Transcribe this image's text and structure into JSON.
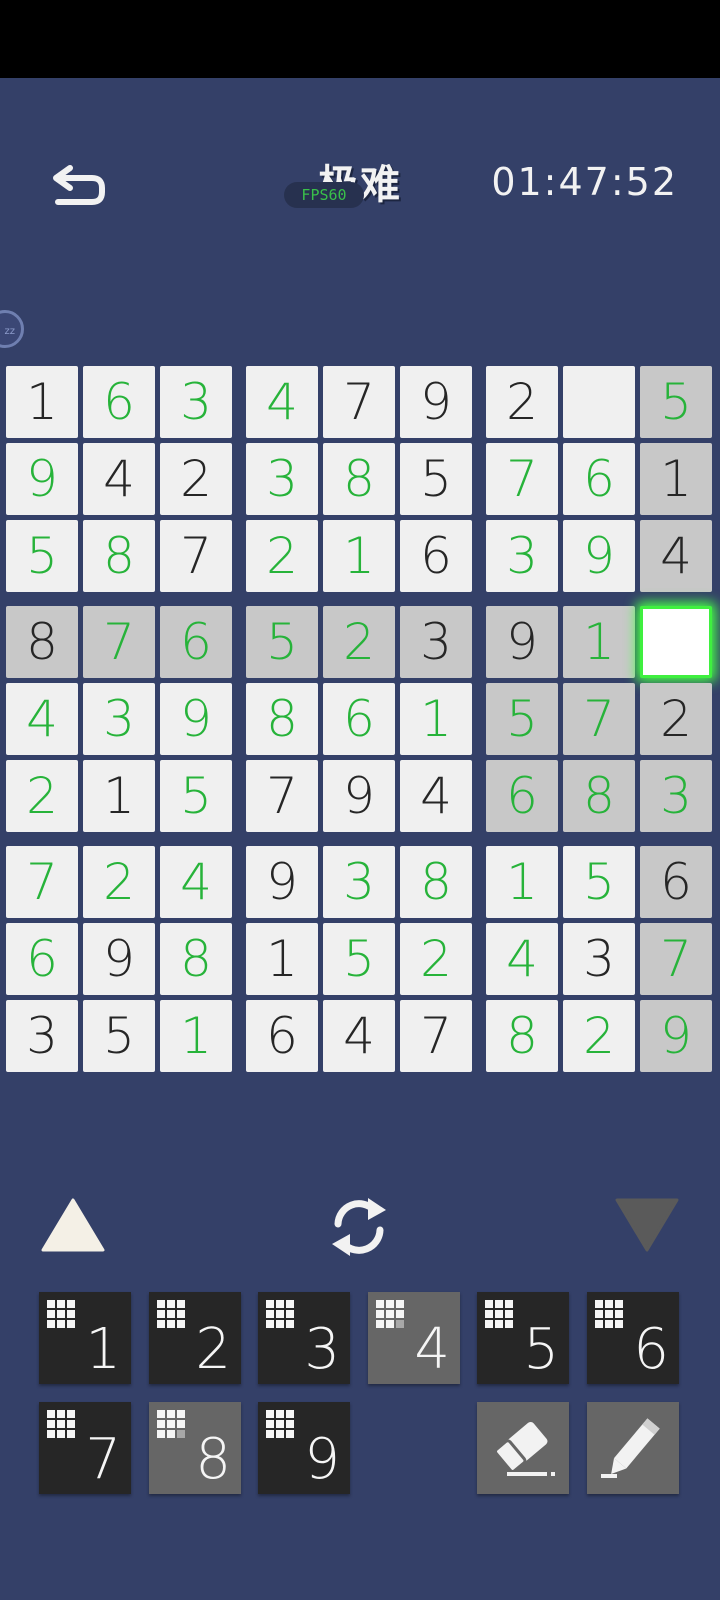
{
  "header": {
    "back_icon": "undo-arrow-icon",
    "difficulty": "极难",
    "fps_badge": "FPS60",
    "timer": "01:47:52",
    "side_bubble": "zz"
  },
  "board": {
    "rows": [
      [
        "1",
        "6",
        "3",
        "4",
        "7",
        "9",
        "2",
        "",
        "5"
      ],
      [
        "9",
        "4",
        "2",
        "3",
        "8",
        "5",
        "7",
        "6",
        "1"
      ],
      [
        "5",
        "8",
        "7",
        "2",
        "1",
        "6",
        "3",
        "9",
        "4"
      ],
      [
        "8",
        "7",
        "6",
        "5",
        "2",
        "3",
        "9",
        "1",
        ""
      ],
      [
        "4",
        "3",
        "9",
        "8",
        "6",
        "1",
        "5",
        "7",
        "2"
      ],
      [
        "2",
        "1",
        "5",
        "7",
        "9",
        "4",
        "6",
        "8",
        "3"
      ],
      [
        "7",
        "2",
        "4",
        "9",
        "3",
        "8",
        "1",
        "5",
        "6"
      ],
      [
        "6",
        "9",
        "8",
        "1",
        "5",
        "2",
        "4",
        "3",
        "7"
      ],
      [
        "3",
        "5",
        "1",
        "6",
        "4",
        "7",
        "8",
        "2",
        "9"
      ]
    ],
    "entered": [
      [
        0,
        1,
        1,
        1,
        0,
        0,
        0,
        0,
        1
      ],
      [
        1,
        0,
        0,
        1,
        1,
        0,
        1,
        1,
        0
      ],
      [
        1,
        1,
        0,
        1,
        1,
        0,
        1,
        1,
        0
      ],
      [
        0,
        1,
        1,
        1,
        1,
        0,
        0,
        1,
        0
      ],
      [
        1,
        1,
        1,
        1,
        1,
        1,
        1,
        1,
        0
      ],
      [
        1,
        0,
        1,
        0,
        0,
        0,
        1,
        1,
        1
      ],
      [
        1,
        1,
        1,
        0,
        1,
        1,
        1,
        1,
        0
      ],
      [
        1,
        0,
        1,
        0,
        1,
        1,
        1,
        0,
        1
      ],
      [
        0,
        0,
        1,
        0,
        0,
        0,
        1,
        1,
        1
      ]
    ],
    "highlighted": [
      [
        0,
        0,
        0,
        0,
        0,
        0,
        0,
        0,
        1
      ],
      [
        0,
        0,
        0,
        0,
        0,
        0,
        0,
        0,
        1
      ],
      [
        0,
        0,
        0,
        0,
        0,
        0,
        0,
        0,
        1
      ],
      [
        1,
        1,
        1,
        1,
        1,
        1,
        1,
        1,
        0
      ],
      [
        0,
        0,
        0,
        0,
        0,
        0,
        1,
        1,
        1
      ],
      [
        0,
        0,
        0,
        0,
        0,
        0,
        1,
        1,
        1
      ],
      [
        0,
        0,
        0,
        0,
        0,
        0,
        0,
        0,
        1
      ],
      [
        0,
        0,
        0,
        0,
        0,
        0,
        0,
        0,
        1
      ],
      [
        0,
        0,
        0,
        0,
        0,
        0,
        0,
        0,
        1
      ]
    ],
    "selected": {
      "row": 3,
      "col": 8
    }
  },
  "controls": {
    "up_icon": "triangle-up-icon",
    "down_icon": "triangle-down-icon",
    "refresh_icon": "refresh-icon"
  },
  "keypad": {
    "keys": [
      {
        "label": "1",
        "highlighted": false,
        "dim_dots": 0
      },
      {
        "label": "2",
        "highlighted": false,
        "dim_dots": 0
      },
      {
        "label": "3",
        "highlighted": false,
        "dim_dots": 0
      },
      {
        "label": "4",
        "highlighted": true,
        "dim_dots": 1
      },
      {
        "label": "5",
        "highlighted": false,
        "dim_dots": 0
      },
      {
        "label": "6",
        "highlighted": false,
        "dim_dots": 0
      },
      {
        "label": "7",
        "highlighted": false,
        "dim_dots": 0
      },
      {
        "label": "8",
        "highlighted": true,
        "dim_dots": 1
      },
      {
        "label": "9",
        "highlighted": false,
        "dim_dots": 0
      }
    ],
    "eraser_icon": "eraser-icon",
    "pencil_icon": "pencil-icon"
  },
  "colors": {
    "background": "#344068",
    "entered_digit": "#27b33a",
    "given_digit": "#262626",
    "cell_white": "#f0f0f0",
    "cell_highlight": "#c8c8c8",
    "selection_glow": "#47ff47"
  }
}
